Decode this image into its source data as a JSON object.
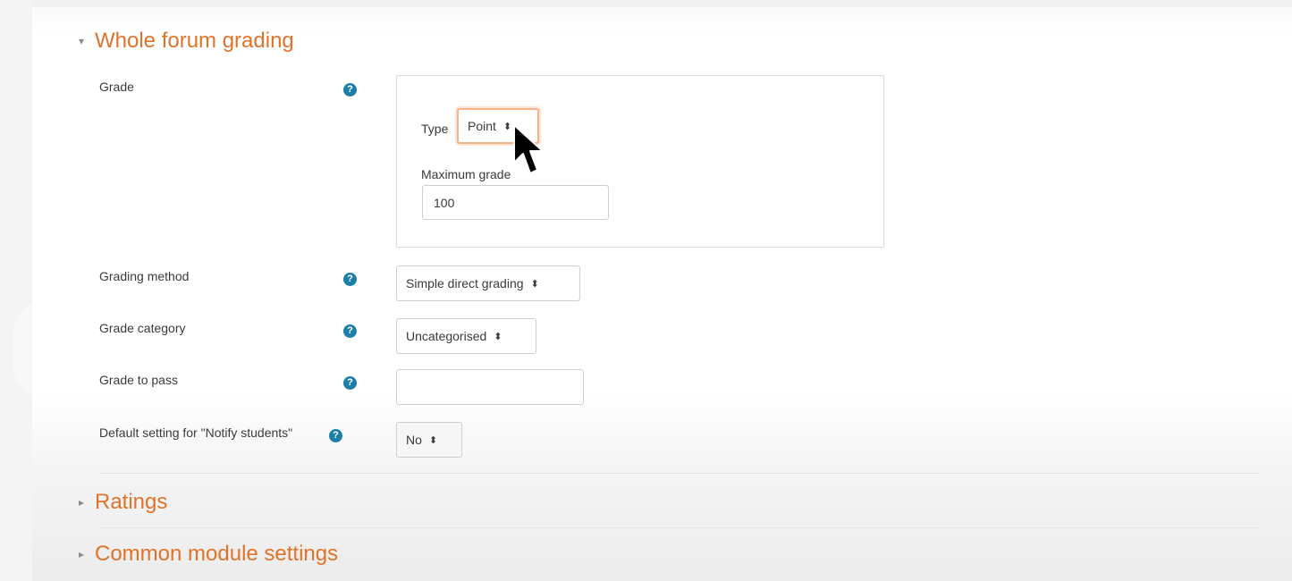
{
  "sections": {
    "whole_forum_grading": {
      "title": "Whole forum grading",
      "caret": "▾"
    },
    "ratings": {
      "title": "Ratings",
      "caret": "▸"
    },
    "common_module_settings": {
      "title": "Common module settings",
      "caret": "▸"
    }
  },
  "form": {
    "grade": {
      "label": "Grade",
      "type_label": "Type",
      "type_value": "Point",
      "max_grade_label": "Maximum grade",
      "max_grade_value": "100"
    },
    "grading_method": {
      "label": "Grading method",
      "value": "Simple direct grading"
    },
    "grade_category": {
      "label": "Grade category",
      "value": "Uncategorised"
    },
    "grade_to_pass": {
      "label": "Grade to pass",
      "value": ""
    },
    "notify_students": {
      "label": "Default setting for \"Notify students\"",
      "value": "No"
    }
  },
  "icons": {
    "help": "?",
    "select_arrows": "⬍"
  },
  "colors": {
    "section_title": "#e0732a",
    "help_icon": "#1d7ea6",
    "focus_ring": "#f4b38a"
  }
}
